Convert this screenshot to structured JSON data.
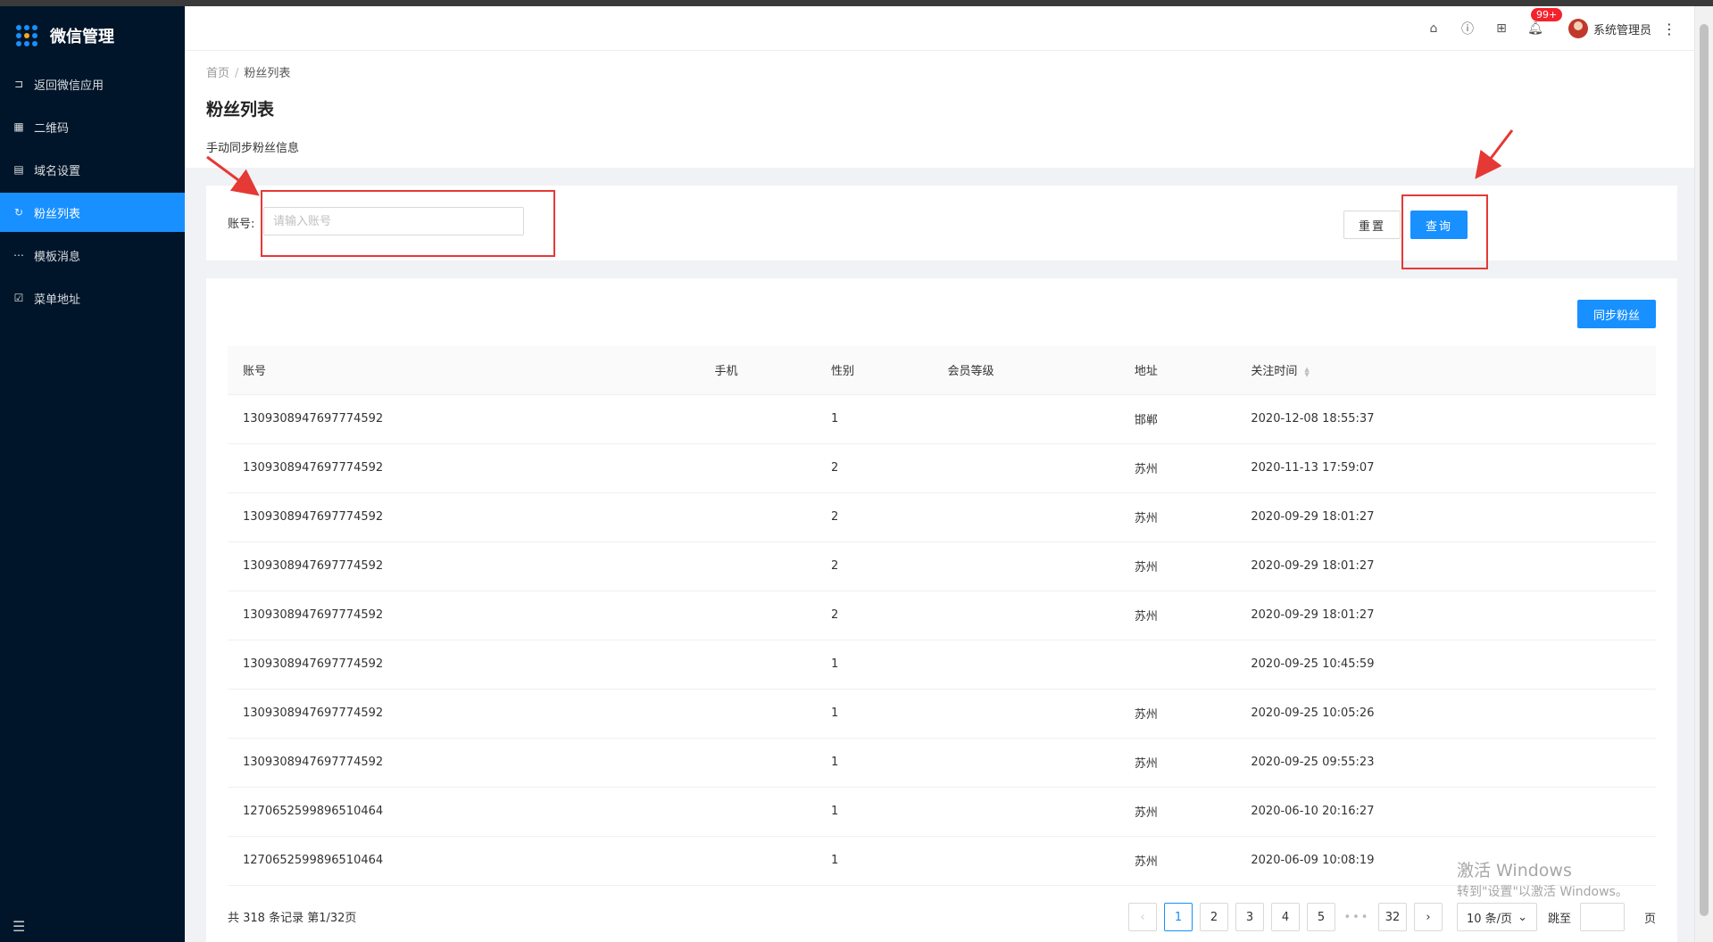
{
  "sidebar": {
    "title": "微信管理",
    "logo_colors": [
      "#1890ff",
      "#1890ff",
      "#1890ff",
      "#1890ff",
      "#f5a623",
      "#1890ff",
      "#1890ff",
      "#1890ff",
      "#1890ff"
    ],
    "items": [
      {
        "label": "返回微信应用",
        "icon": "return-icon",
        "glyph": "⊐",
        "active": false
      },
      {
        "label": "二维码",
        "icon": "qrcode-icon",
        "glyph": "▦",
        "active": false
      },
      {
        "label": "域名设置",
        "icon": "document-icon",
        "glyph": "▤",
        "active": false
      },
      {
        "label": "粉丝列表",
        "icon": "sync-icon",
        "glyph": "↻",
        "active": true
      },
      {
        "label": "模板消息",
        "icon": "message-icon",
        "glyph": "⋯",
        "active": false
      },
      {
        "label": "菜单地址",
        "icon": "checklist-icon",
        "glyph": "☑",
        "active": false
      }
    ]
  },
  "header": {
    "badge": "99+",
    "username": "系统管理员"
  },
  "page": {
    "breadcrumb_home": "首页",
    "breadcrumb_sep": "/",
    "breadcrumb_current": "粉丝列表",
    "title": "粉丝列表",
    "description": "手动同步粉丝信息"
  },
  "search": {
    "label": "账号:",
    "placeholder": "请输入账号",
    "value": "",
    "reset_label": "重置",
    "query_label": "查询"
  },
  "table": {
    "sync_label": "同步粉丝",
    "columns": [
      "账号",
      "手机",
      "性别",
      "会员等级",
      "地址",
      "关注时间"
    ],
    "rows": [
      [
        "1309308947697774592",
        "",
        "1",
        "",
        "邯郸",
        "2020-12-08 18:55:37"
      ],
      [
        "1309308947697774592",
        "",
        "2",
        "",
        "苏州",
        "2020-11-13 17:59:07"
      ],
      [
        "1309308947697774592",
        "",
        "2",
        "",
        "苏州",
        "2020-09-29 18:01:27"
      ],
      [
        "1309308947697774592",
        "",
        "2",
        "",
        "苏州",
        "2020-09-29 18:01:27"
      ],
      [
        "1309308947697774592",
        "",
        "2",
        "",
        "苏州",
        "2020-09-29 18:01:27"
      ],
      [
        "1309308947697774592",
        "",
        "1",
        "",
        "",
        "2020-09-25 10:45:59"
      ],
      [
        "1309308947697774592",
        "",
        "1",
        "",
        "苏州",
        "2020-09-25 10:05:26"
      ],
      [
        "1309308947697774592",
        "",
        "1",
        "",
        "苏州",
        "2020-09-25 09:55:23"
      ],
      [
        "1270652599896510464",
        "",
        "1",
        "",
        "苏州",
        "2020-06-10 20:16:27"
      ],
      [
        "1270652599896510464",
        "",
        "1",
        "",
        "苏州",
        "2020-06-09 10:08:19"
      ]
    ]
  },
  "pagination": {
    "total_text": "共 318 条记录 第1/32页",
    "pages": [
      "1",
      "2",
      "3",
      "4",
      "5"
    ],
    "ellipsis": "•••",
    "last_page": "32",
    "current": "1",
    "page_size": "10 条/页",
    "jump_label": "跳至",
    "page_unit": "页"
  },
  "watermark": {
    "line1": "激活 Windows",
    "line2": "转到\"设置\"以激活 Windows。"
  },
  "colors": {
    "sidebar_bg": "#001529",
    "primary": "#1890ff",
    "annotation": "#e53935"
  }
}
